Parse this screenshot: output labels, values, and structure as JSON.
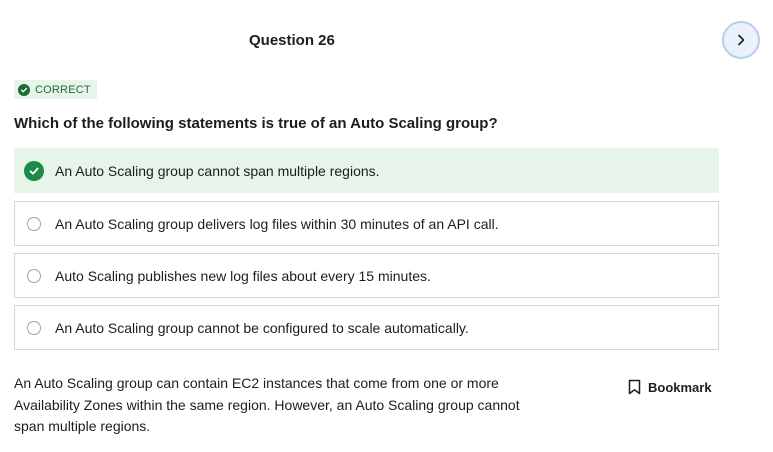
{
  "question": {
    "number_label": "Question 26",
    "status": "CORRECT",
    "prompt": "Which of the following statements is true of an Auto Scaling group?"
  },
  "options": [
    {
      "text": "An Auto Scaling group cannot span multiple regions.",
      "selected": true
    },
    {
      "text": "An Auto Scaling group delivers log files within 30 minutes of an API call.",
      "selected": false
    },
    {
      "text": "Auto Scaling publishes new log files about every 15 minutes.",
      "selected": false
    },
    {
      "text": "An Auto Scaling group cannot be configured to scale automatically.",
      "selected": false
    }
  ],
  "explanation": "An Auto Scaling group can contain EC2 instances that come from one or more Availability Zones within the same region. However, an Auto Scaling group cannot span multiple regions.",
  "bookmark_label": "Bookmark",
  "icons": {
    "next": "chevron-right-icon",
    "status": "check-circle-icon",
    "bookmark": "bookmark-icon"
  },
  "colors": {
    "correct_green": "#1e8a4a",
    "correct_bg": "#e6f4ea",
    "next_button_bg": "#eaf1fb"
  }
}
